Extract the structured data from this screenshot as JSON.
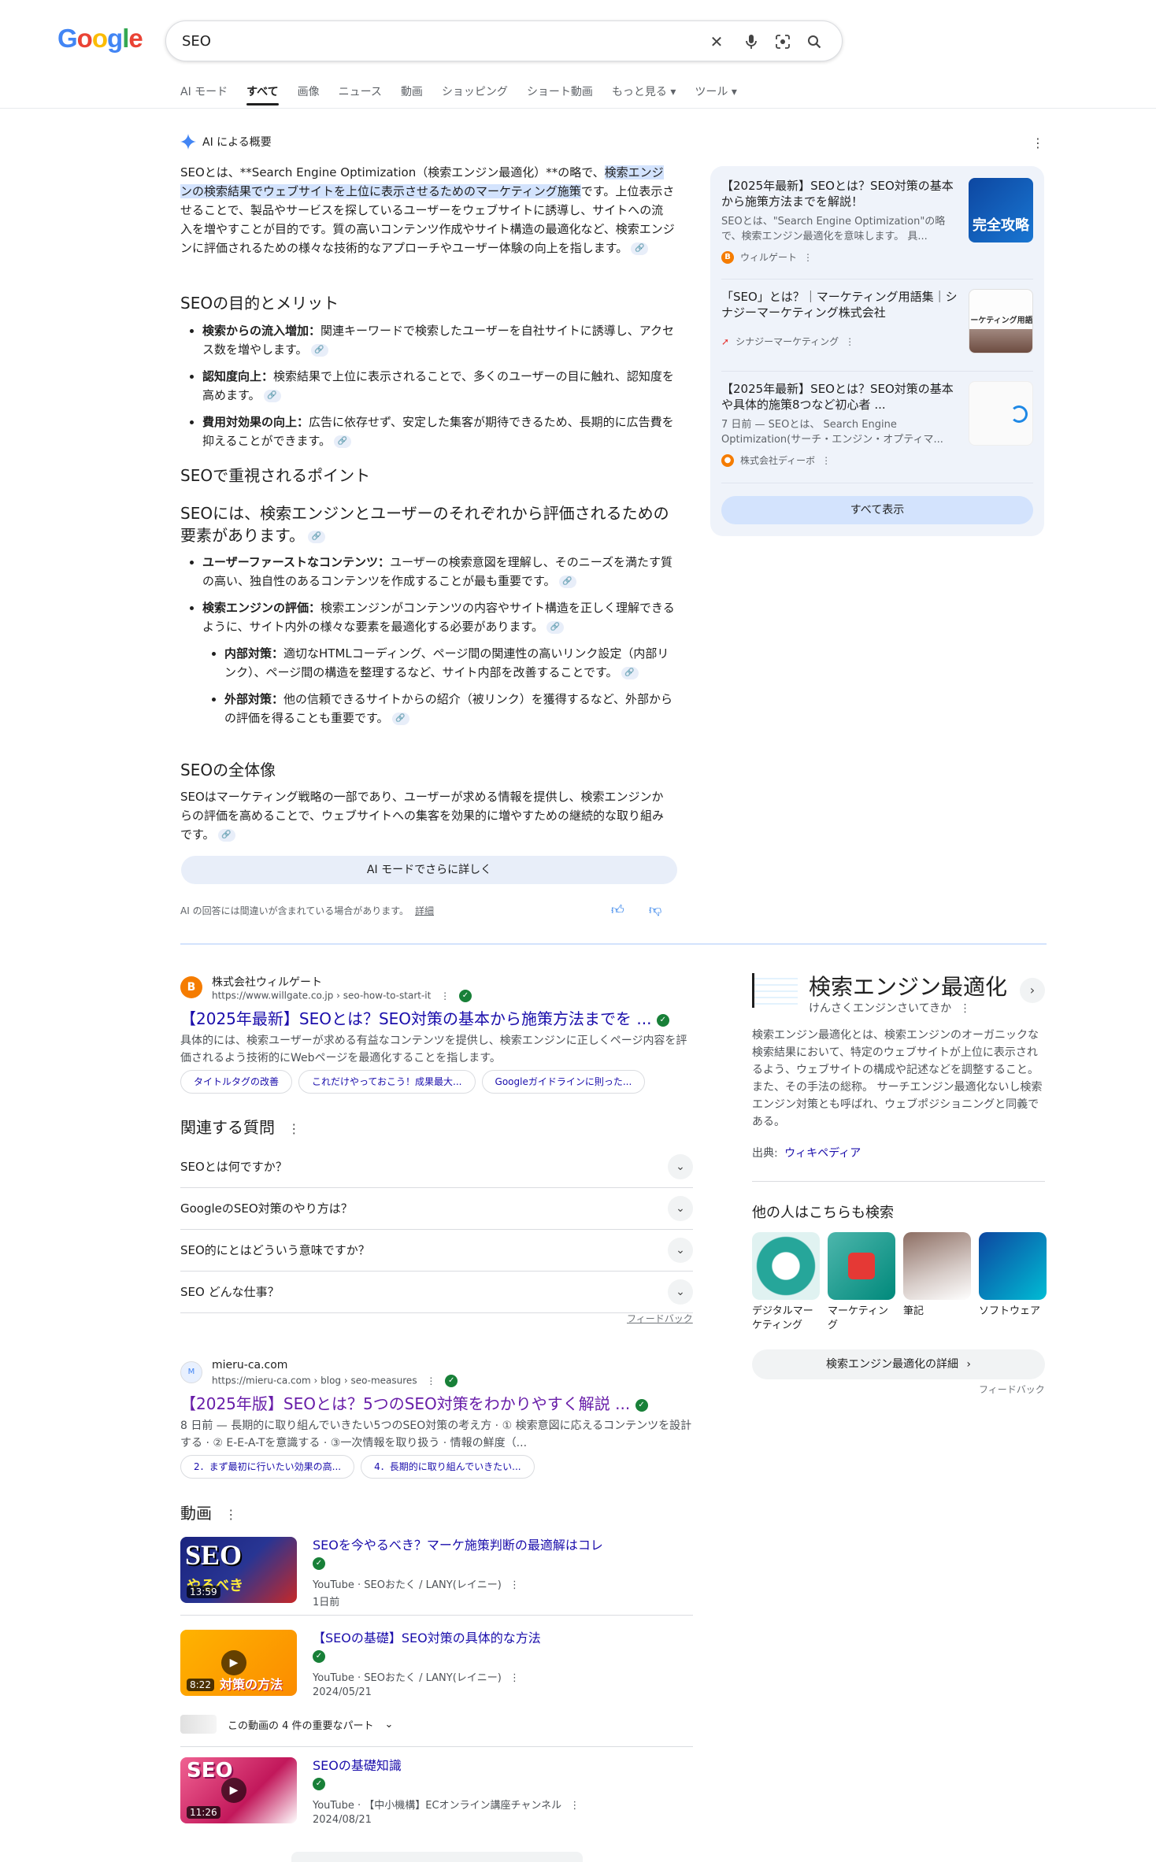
{
  "logo": "Google",
  "search": {
    "query": "SEO"
  },
  "tabs": [
    "AI モード",
    "すべて",
    "画像",
    "ニュース",
    "動画",
    "ショッピング",
    "ショート動画",
    "もっと見る ▾",
    "ツール ▾"
  ],
  "ai": {
    "header": "AI による概要",
    "intro_pre": "SEOとは、**Search Engine Optimization（検索エンジン最適化）**の略で、",
    "intro_hl": "検索エンジンの検索結果でウェブサイトを上位に表示させるためのマーケティング施策",
    "intro_post": "です。上位表示させることで、製品やサービスを探しているユーザーをウェブサイトに誘導し、サイトへの流入を増やすことが目的です。質の高いコンテンツ作成やサイト構造の最適化など、検索エンジンに評価されるための様々な技術的なアプローチやユーザー体験の向上を指します。",
    "h_purpose": "SEOの目的とメリット",
    "purpose": [
      {
        "b": "検索からの流入増加：",
        "t": "関連キーワードで検索したユーザーを自社サイトに誘導し、アクセス数を増やします。"
      },
      {
        "b": "認知度向上：",
        "t": "検索結果で上位に表示されることで、多くのユーザーの目に触れ、認知度を高めます。"
      },
      {
        "b": "費用対効果の向上：",
        "t": "広告に依存せず、安定した集客が期待できるため、長期的に広告費を抑えることができます。"
      }
    ],
    "h_points": "SEOで重視されるポイント",
    "h_points2": "SEOには、検索エンジンとユーザーのそれぞれから評価されるための要素があります。",
    "points": [
      {
        "b": "ユーザーファーストなコンテンツ：",
        "t": "ユーザーの検索意図を理解し、そのニーズを満たす質の高い、独自性のあるコンテンツを作成することが最も重要です。"
      },
      {
        "b": "検索エンジンの評価：",
        "t": "検索エンジンがコンテンツの内容やサイト構造を正しく理解できるように、サイト内外の様々な要素を最適化する必要があります。"
      }
    ],
    "sub_points": [
      {
        "b": "内部対策：",
        "t": "適切なHTMLコーディング、ページ間の関連性の高いリンク設定（内部リンク）、ページ間の構造を整理するなど、サイト内部を改善することです。"
      },
      {
        "b": "外部対策：",
        "t": "他の信頼できるサイトからの紹介（被リンク）を獲得するなど、外部からの評価を得ることも重要です。"
      }
    ],
    "h_whole": "SEOの全体像",
    "whole": "SEOはマーケティング戦略の一部であり、ユーザーが求める情報を提供し、検索エンジンからの評価を高めることで、ウェブサイトへの集客を効果的に増やすための継続的な取り組みです。",
    "more_button": "AI モードでさらに詳しく",
    "disclaimer": "AI の回答には間違いが含まれている場合があります。",
    "details": "詳細",
    "sources": [
      {
        "title": "【2025年最新】SEOとは？SEO対策の基本から施策方法までを解説！",
        "snippet": "SEOとは、\"Search Engine Optimization\"の略で、検索エンジン最適化を意味します。 具...",
        "site": "ウィルゲート",
        "thumb": "完全攻略"
      },
      {
        "title": "「SEO」とは？｜マーケティング用語集｜シナジーマーケティング株式会社",
        "snippet": "",
        "site": "シナジーマーケティング",
        "thumb": "ーケティング用語"
      },
      {
        "title": "【2025年最新】SEOとは？SEO対策の基本や具体的施策8つなど初心者 ...",
        "snippet": "7 日前 — SEOとは、 Search Engine Optimization(サーチ・エンジン・オプティマ...",
        "site": "株式会社ディーボ",
        "thumb": ""
      }
    ],
    "show_all": "すべて表示"
  },
  "result1": {
    "site": "株式会社ウィルゲート",
    "url": "https://www.willgate.co.jp › seo-how-to-start-it",
    "title": "【2025年最新】SEOとは？SEO対策の基本から施策方法までを ...",
    "snippet": "具体的には、検索ユーザーが求める有益なコンテンツを提供し、検索エンジンに正しくページ内容を評価されるよう技術的にWebページを最適化することを指します。",
    "chips": [
      "タイトルタグの改善",
      "これだけやっておこう！成果最大...",
      "Googleガイドラインに則った..."
    ]
  },
  "paa": {
    "title": "関連する質問",
    "questions": [
      "SEOとは何ですか？",
      "GoogleのSEO対策のやり方は？",
      "SEO的にとはどういう意味ですか？",
      "SEO どんな仕事？"
    ],
    "feedback": "フィードバック"
  },
  "result2": {
    "site": "mieru-ca.com",
    "url": "https://mieru-ca.com › blog › seo-measures",
    "title": "【2025年版】SEOとは？5つのSEO対策をわかりやすく解説 ...",
    "snippet": "8 日前 — 長期的に取り組んでいきたい5つのSEO対策の考え方 · ① 検索意図に応えるコンテンツを設計する · ② E-E-A-Tを意識する · ③一次情報を取り扱う · 情報の鮮度（...",
    "chips": [
      "2．まず最初に行いたい効果の高...",
      "4．長期的に取り組んでいきたい..."
    ]
  },
  "videos": {
    "title": "動画",
    "items": [
      {
        "title": "SEOを今やるべき？マーケ施策判断の最適解はコレ",
        "source": "YouTube · SEOおたく / LANY(レイニー)",
        "date": "1日前",
        "duration": "13:59",
        "thumb": "SEO"
      },
      {
        "title": "【SEOの基礎】SEO対策の具体的な方法",
        "source": "YouTube · SEOおたく / LANY(レイニー)",
        "date": "2024/05/21",
        "duration": "8:22",
        "thumb": "対策の方法"
      },
      {
        "title": "SEOの基礎知識",
        "source": "YouTube · 【中小機構】ECオンライン講座チャンネル",
        "date": "2024/08/21",
        "duration": "11:26",
        "thumb": "SEO"
      }
    ],
    "key_parts": "この動画の 4 件の重要なパート"
  },
  "kp": {
    "title": "検索エンジン最適化",
    "reading": "けんさくエンジンさいてきか",
    "desc": "検索エンジン最適化とは、検索エンジンのオーガニックな検索結果において、特定のウェブサイトが上位に表示されるよう、ウェブサイトの構成や記述などを調整すること。また、その手法の総称。 サーチエンジン最適化ないし検索エンジン対策とも呼ばれ、ウェブポジショニングと同義である。",
    "source_label": "出典:",
    "source": "ウィキペディア",
    "also_title": "他の人はこちらも検索",
    "also": [
      "デジタルマーケティング",
      "マーケティング",
      "筆記",
      "ソフトウェア"
    ],
    "details_button": "検索エンジン最適化の詳細",
    "feedback": "フィードバック"
  }
}
